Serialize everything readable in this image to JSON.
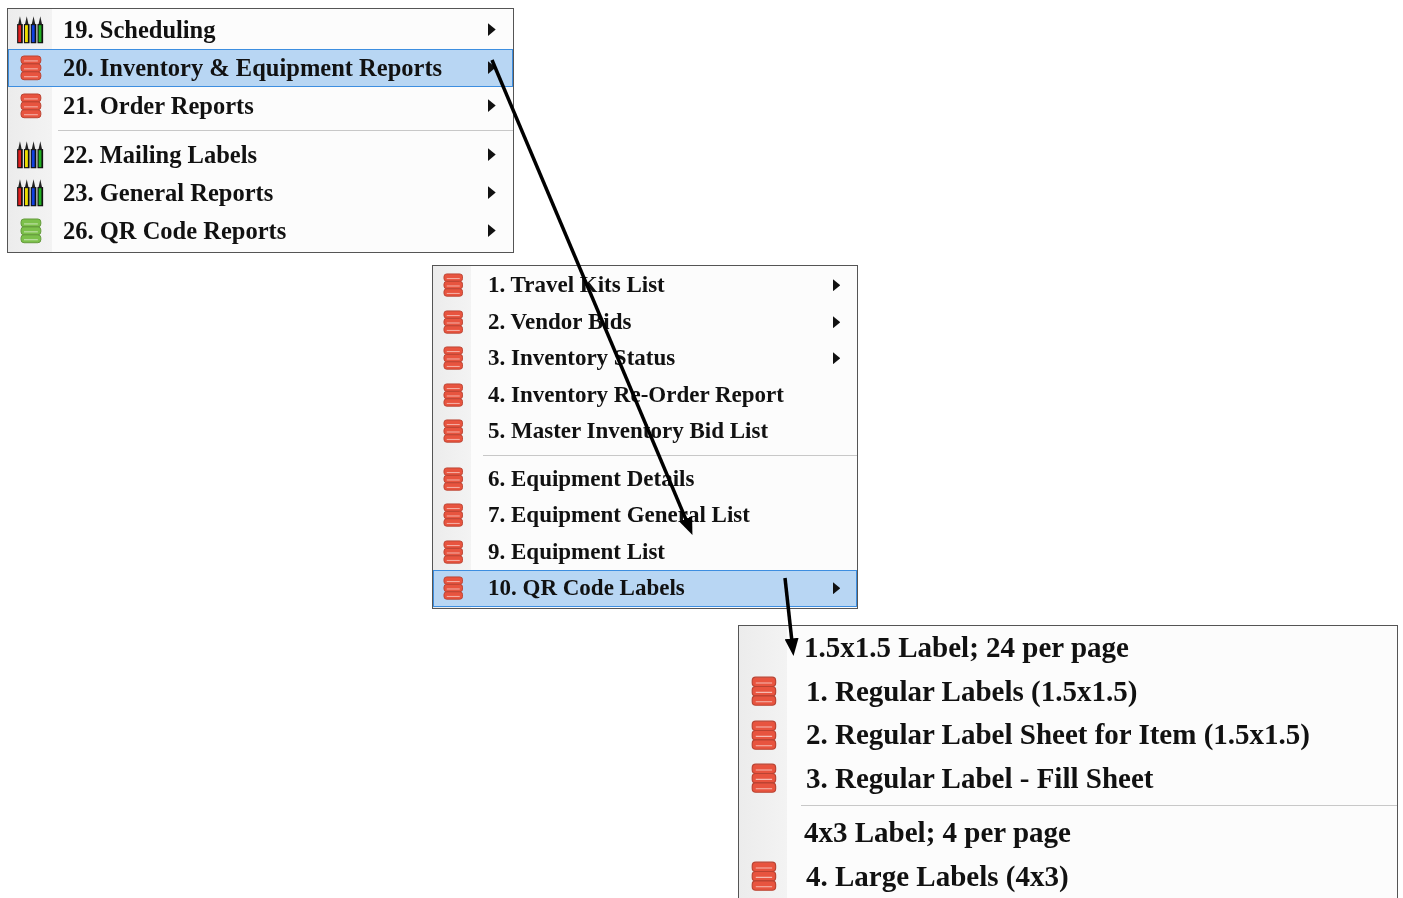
{
  "menus": [
    {
      "items": [
        {
          "kind": "pencils",
          "label": "19. Scheduling",
          "submenu": true,
          "selected": false
        },
        {
          "kind": "database",
          "label": "20. Inventory & Equipment Reports",
          "color": "#e8543f",
          "submenu": true,
          "selected": true
        },
        {
          "kind": "database",
          "label": "21. Order Reports",
          "color": "#e8543f",
          "submenu": true,
          "selected": false
        },
        {
          "kind": "separator"
        },
        {
          "kind": "pencils",
          "label": "22. Mailing Labels",
          "submenu": true,
          "selected": false
        },
        {
          "kind": "pencils",
          "label": "23. General Reports",
          "submenu": true,
          "selected": false
        },
        {
          "kind": "database",
          "label": "26. QR Code Reports",
          "color": "#7cc04a",
          "submenu": true,
          "selected": false
        }
      ]
    },
    {
      "items": [
        {
          "kind": "database",
          "label": "1. Travel Kits List",
          "color": "#e8543f",
          "submenu": true,
          "selected": false
        },
        {
          "kind": "database",
          "label": "2. Vendor Bids",
          "color": "#e8543f",
          "submenu": true,
          "selected": false
        },
        {
          "kind": "database",
          "label": "3. Inventory Status",
          "color": "#e8543f",
          "submenu": true,
          "selected": false
        },
        {
          "kind": "database",
          "label": "4. Inventory Re-Order Report",
          "color": "#e8543f",
          "submenu": false,
          "selected": false
        },
        {
          "kind": "database",
          "label": "5. Master Inventory Bid List",
          "color": "#e8543f",
          "submenu": false,
          "selected": false
        },
        {
          "kind": "separator"
        },
        {
          "kind": "database",
          "label": "6. Equipment Details",
          "color": "#e8543f",
          "submenu": false,
          "selected": false
        },
        {
          "kind": "database",
          "label": "7. Equipment General List",
          "color": "#e8543f",
          "submenu": false,
          "selected": false
        },
        {
          "kind": "database",
          "label": "9. Equipment List",
          "color": "#e8543f",
          "submenu": false,
          "selected": false
        },
        {
          "kind": "database",
          "label": "10. QR Code Labels",
          "color": "#e8543f",
          "submenu": true,
          "selected": true
        }
      ]
    },
    {
      "items": [
        {
          "kind": "heading",
          "label": "1.5x1.5 Label; 24 per page"
        },
        {
          "kind": "database",
          "label": "1. Regular Labels (1.5x1.5)",
          "color": "#e8543f",
          "submenu": false,
          "selected": false
        },
        {
          "kind": "database",
          "label": "2. Regular Label Sheet for Item (1.5x1.5)",
          "color": "#e8543f",
          "submenu": false,
          "selected": false
        },
        {
          "kind": "database",
          "label": "3. Regular Label - Fill Sheet",
          "color": "#e8543f",
          "submenu": false,
          "selected": false
        },
        {
          "kind": "separator"
        },
        {
          "kind": "heading",
          "label": "4x3 Label; 4 per page"
        },
        {
          "kind": "database",
          "label": "4. Large Labels (4x3)",
          "color": "#e8543f",
          "submenu": false,
          "selected": false
        }
      ]
    }
  ]
}
